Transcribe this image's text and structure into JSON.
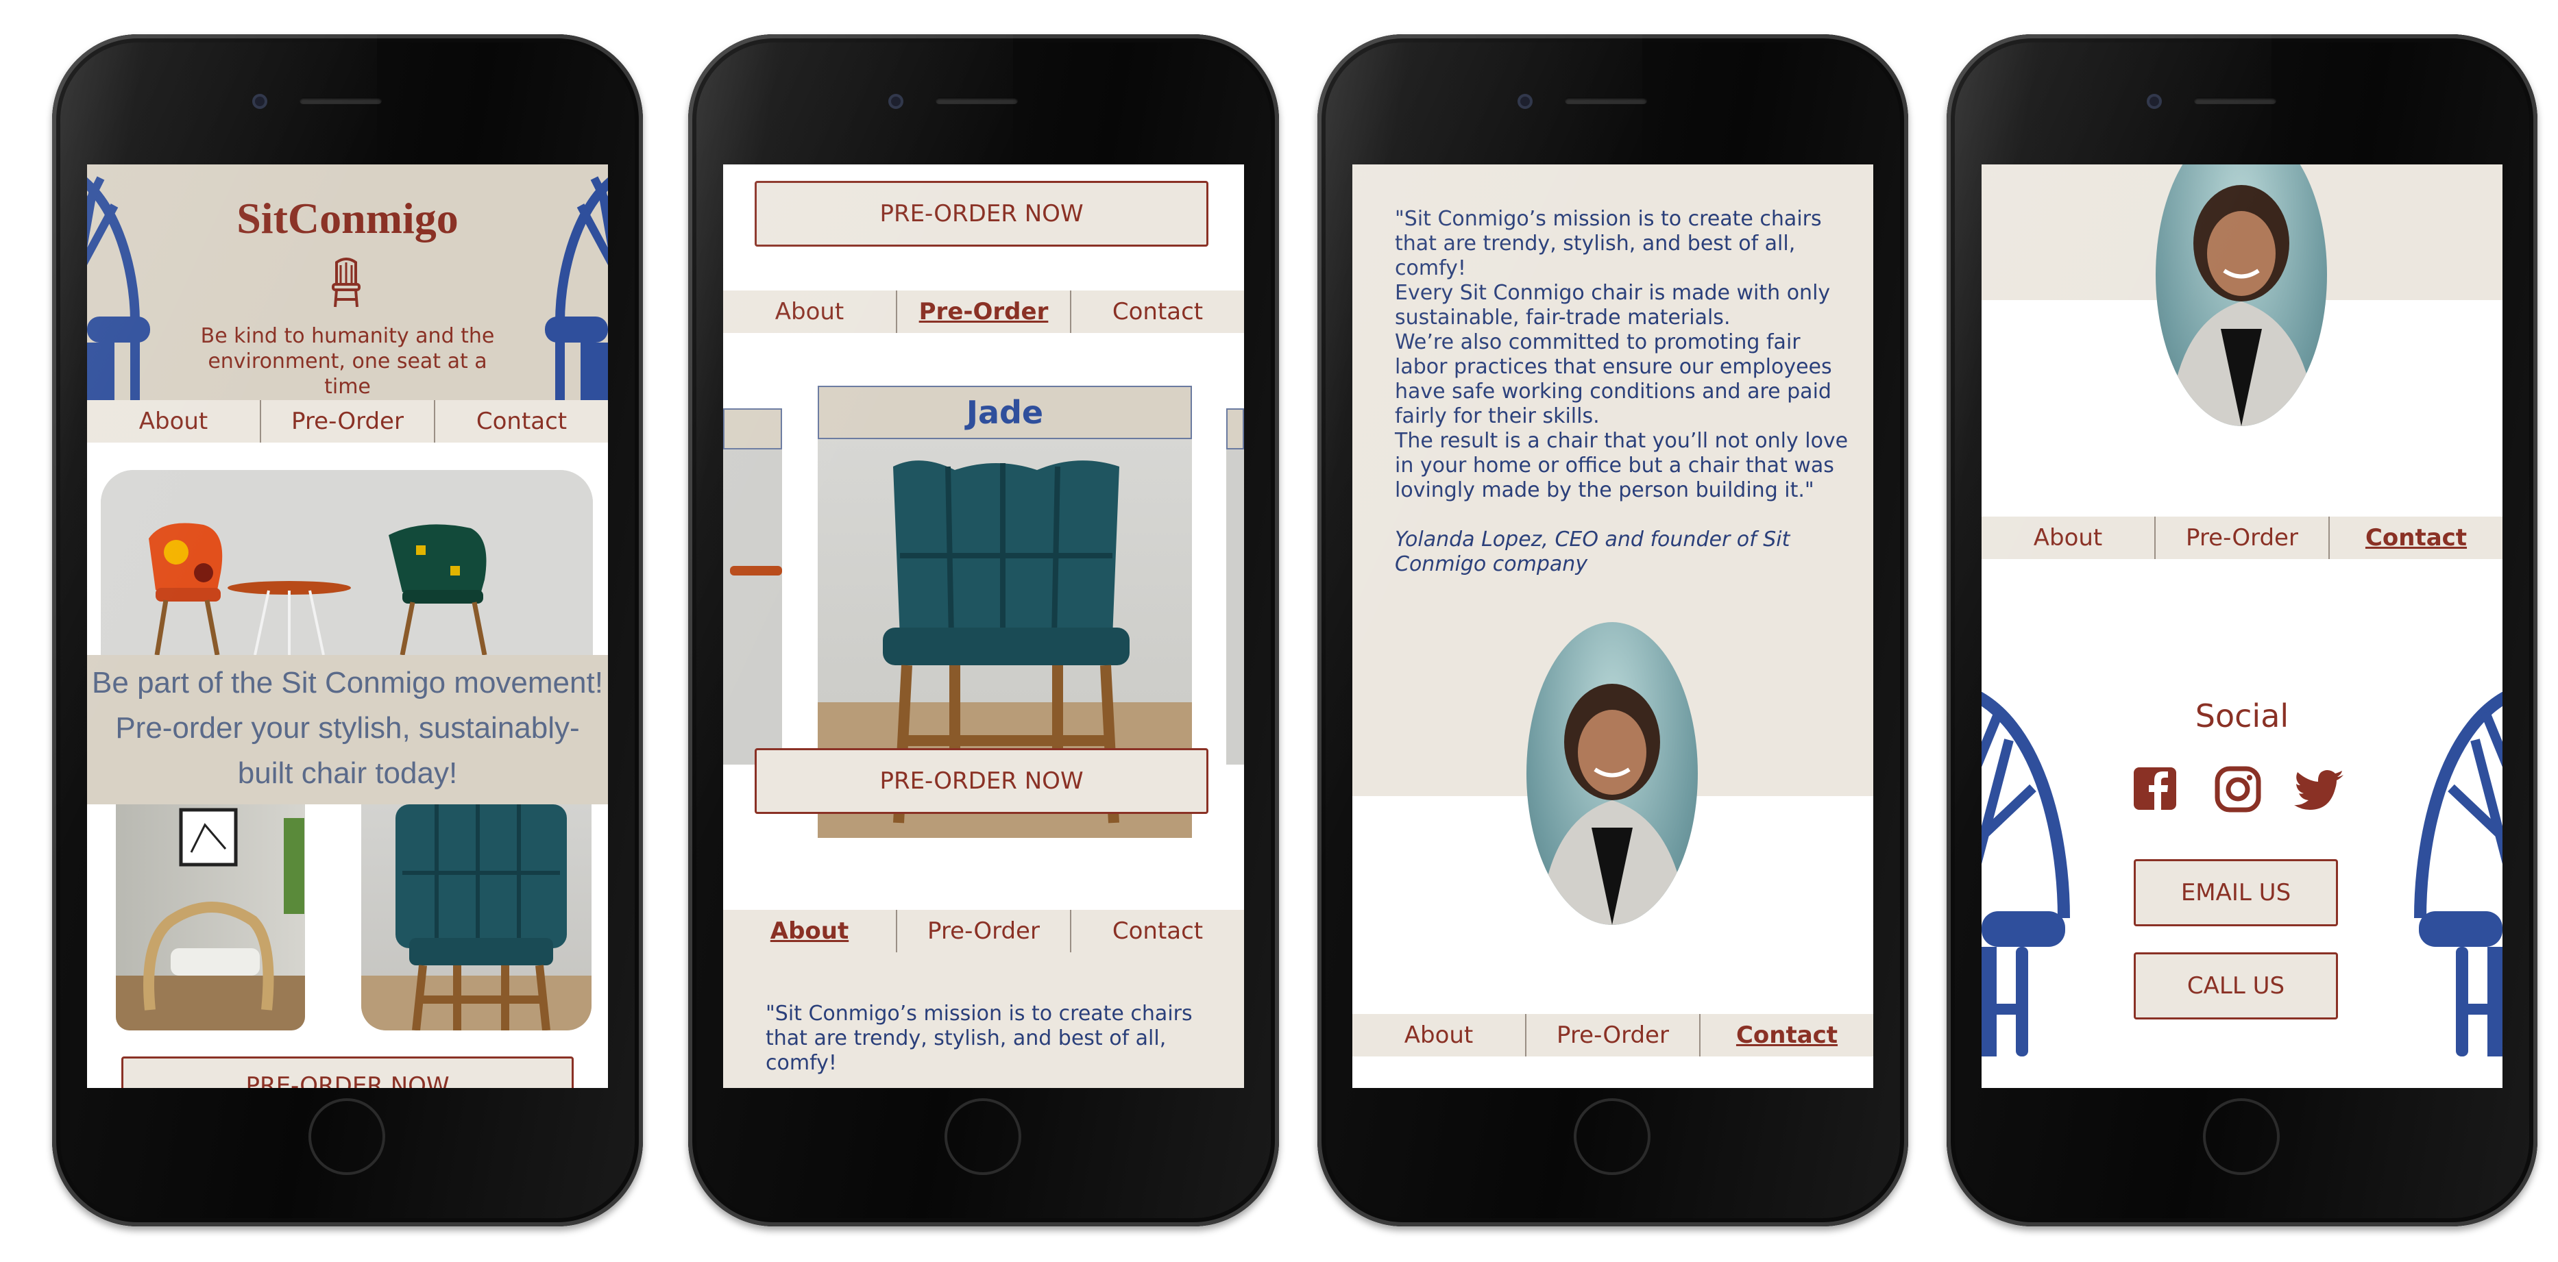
{
  "colors": {
    "brand": "#8a3125",
    "navy": "#2a3f7a",
    "chair_blue": "#2f4f9c",
    "beige": "#d9d2c5",
    "cream": "#ece7df",
    "teal_chair": "#1f5560"
  },
  "nav": {
    "about": "About",
    "preorder": "Pre-Order",
    "contact": "Contact"
  },
  "screen1": {
    "logo": "SitConmigo",
    "tagline": "Be kind to humanity and the environment, one seat at a time",
    "movement_line1": "Be part of the Sit Conmigo movement!",
    "movement_line2": "Pre-order your stylish, sustainably-",
    "movement_line3": "built chair today!",
    "preorder_btn": "PRE-ORDER NOW",
    "icons": [
      "chair-icon",
      "chair-silhouette-icon"
    ]
  },
  "screen2": {
    "preorder_btn_top": "PRE-ORDER NOW",
    "product_name": "Jade",
    "preorder_btn_bottom": "PRE-ORDER NOW",
    "quote_partial": "\"Sit Conmigo’s mission is to create chairs that are trendy, stylish, and best of all, comfy!"
  },
  "screen3": {
    "quote": "\"Sit Conmigo’s mission is to create chairs that are trendy, stylish, and best of all, comfy!\nEvery Sit Conmigo chair is made with only sustainable, fair-trade materials.\nWe’re also committed to promoting fair labor practices that ensure our employees have safe working conditions and are paid fairly for their skills.\nThe result is a chair that you’ll not only love in your home or office but a chair that was lovingly made by the person building it.\"",
    "attribution": "Yolanda Lopez, CEO and founder of Sit Conmigo company"
  },
  "screen4": {
    "social_heading": "Social",
    "email_btn": "EMAIL US",
    "call_btn": "CALL US",
    "icons": [
      "facebook-icon",
      "instagram-icon",
      "twitter-icon"
    ]
  }
}
